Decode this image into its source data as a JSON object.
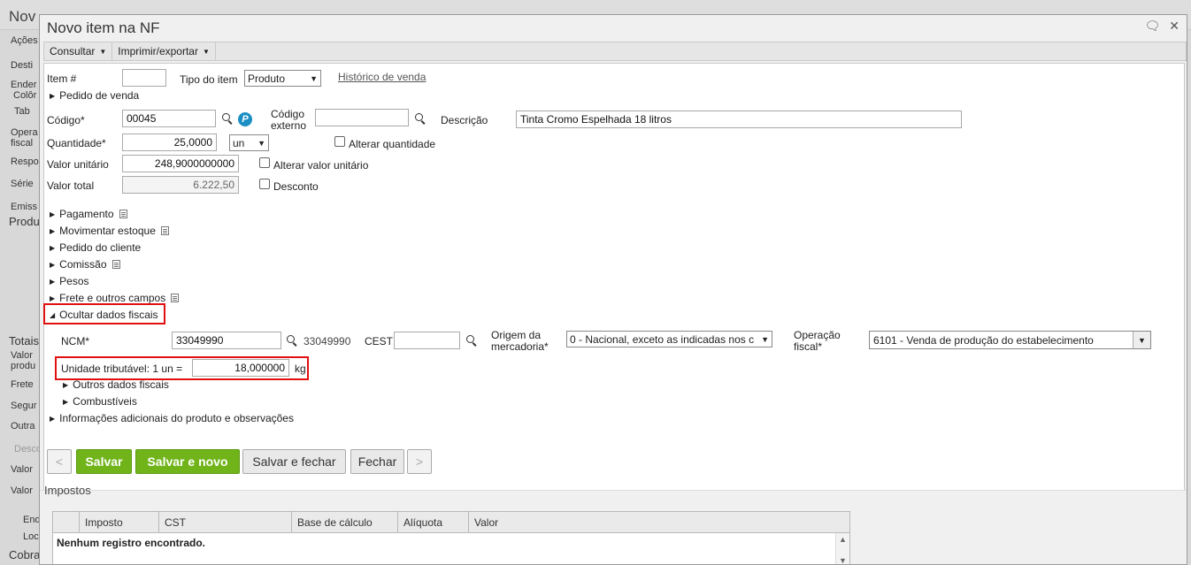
{
  "background": {
    "title": "Nov",
    "labels": [
      "Ações",
      "Desti",
      "Ender",
      "Colôr",
      "Tab",
      "Opera",
      "fiscal",
      "Respo",
      "Série",
      "Emiss",
      "Produ",
      "Totais",
      "Valor",
      "produ",
      "Frete",
      "Segur",
      "Outra",
      "Desco",
      "Valor",
      "Valor",
      "End",
      "Loc",
      "Cobra"
    ]
  },
  "dialog": {
    "title": "Novo item na NF"
  },
  "menu": {
    "consultar": "Consultar",
    "imprimir": "Imprimir/exportar"
  },
  "form": {
    "item_label": "Item #",
    "item_value": "",
    "tipo_label": "Tipo do item",
    "tipo_value": "Produto",
    "historico_link": "Histórico de venda",
    "pedido_venda": "Pedido de venda",
    "codigo_label": "Código*",
    "codigo_value": "00045",
    "codigo_externo_label_1": "Código",
    "codigo_externo_label_2": "externo",
    "codigo_externo_value": "",
    "descricao_label": "Descrição",
    "descricao_value": "Tinta Cromo Espelhada 18 litros",
    "quantidade_label": "Quantidade*",
    "quantidade_value": "25,0000",
    "unidade_value": "un",
    "alterar_quantidade": "Alterar quantidade",
    "valor_unitario_label": "Valor unitário",
    "valor_unitario_value": "248,9000000000",
    "alterar_valor_unitario": "Alterar valor unitário",
    "valor_total_label": "Valor total",
    "valor_total_value": "6.222,50",
    "desconto": "Desconto"
  },
  "sections": {
    "pagamento": "Pagamento",
    "movimentar": "Movimentar estoque",
    "pedido_cliente": "Pedido do cliente",
    "comissao": "Comissão",
    "pesos": "Pesos",
    "frete": "Frete e outros campos",
    "ocultar": "Ocultar dados fiscais",
    "outros": "Outros dados fiscais",
    "combustiveis": "Combustíveis",
    "info": "Informações adicionais do produto e observações"
  },
  "fiscal": {
    "ncm_label": "NCM*",
    "ncm_value": "33049990",
    "ncm_text": "33049990",
    "cest_label": "CEST",
    "cest_value": "",
    "origem_label_1": "Origem da",
    "origem_label_2": "mercadoria*",
    "origem_value": "0 - Nacional, exceto as indicadas nos c",
    "operacao_label_1": "Operação",
    "operacao_label_2": "fiscal*",
    "operacao_value": "6101 - Venda de produção do estabelecimento",
    "unidade_trib_label": "Unidade tributável: 1 un =",
    "unidade_trib_value": "18,000000",
    "unidade_trib_unit": "kg"
  },
  "buttons": {
    "prev": "<",
    "salvar": "Salvar",
    "salvar_novo": "Salvar e novo",
    "salvar_fechar": "Salvar e fechar",
    "fechar": "Fechar",
    "next": ">"
  },
  "impostos": {
    "title": "Impostos",
    "columns": [
      "Imposto",
      "CST",
      "Base de cálculo",
      "Alíquota",
      "Valor"
    ],
    "empty": "Nenhum registro encontrado."
  }
}
